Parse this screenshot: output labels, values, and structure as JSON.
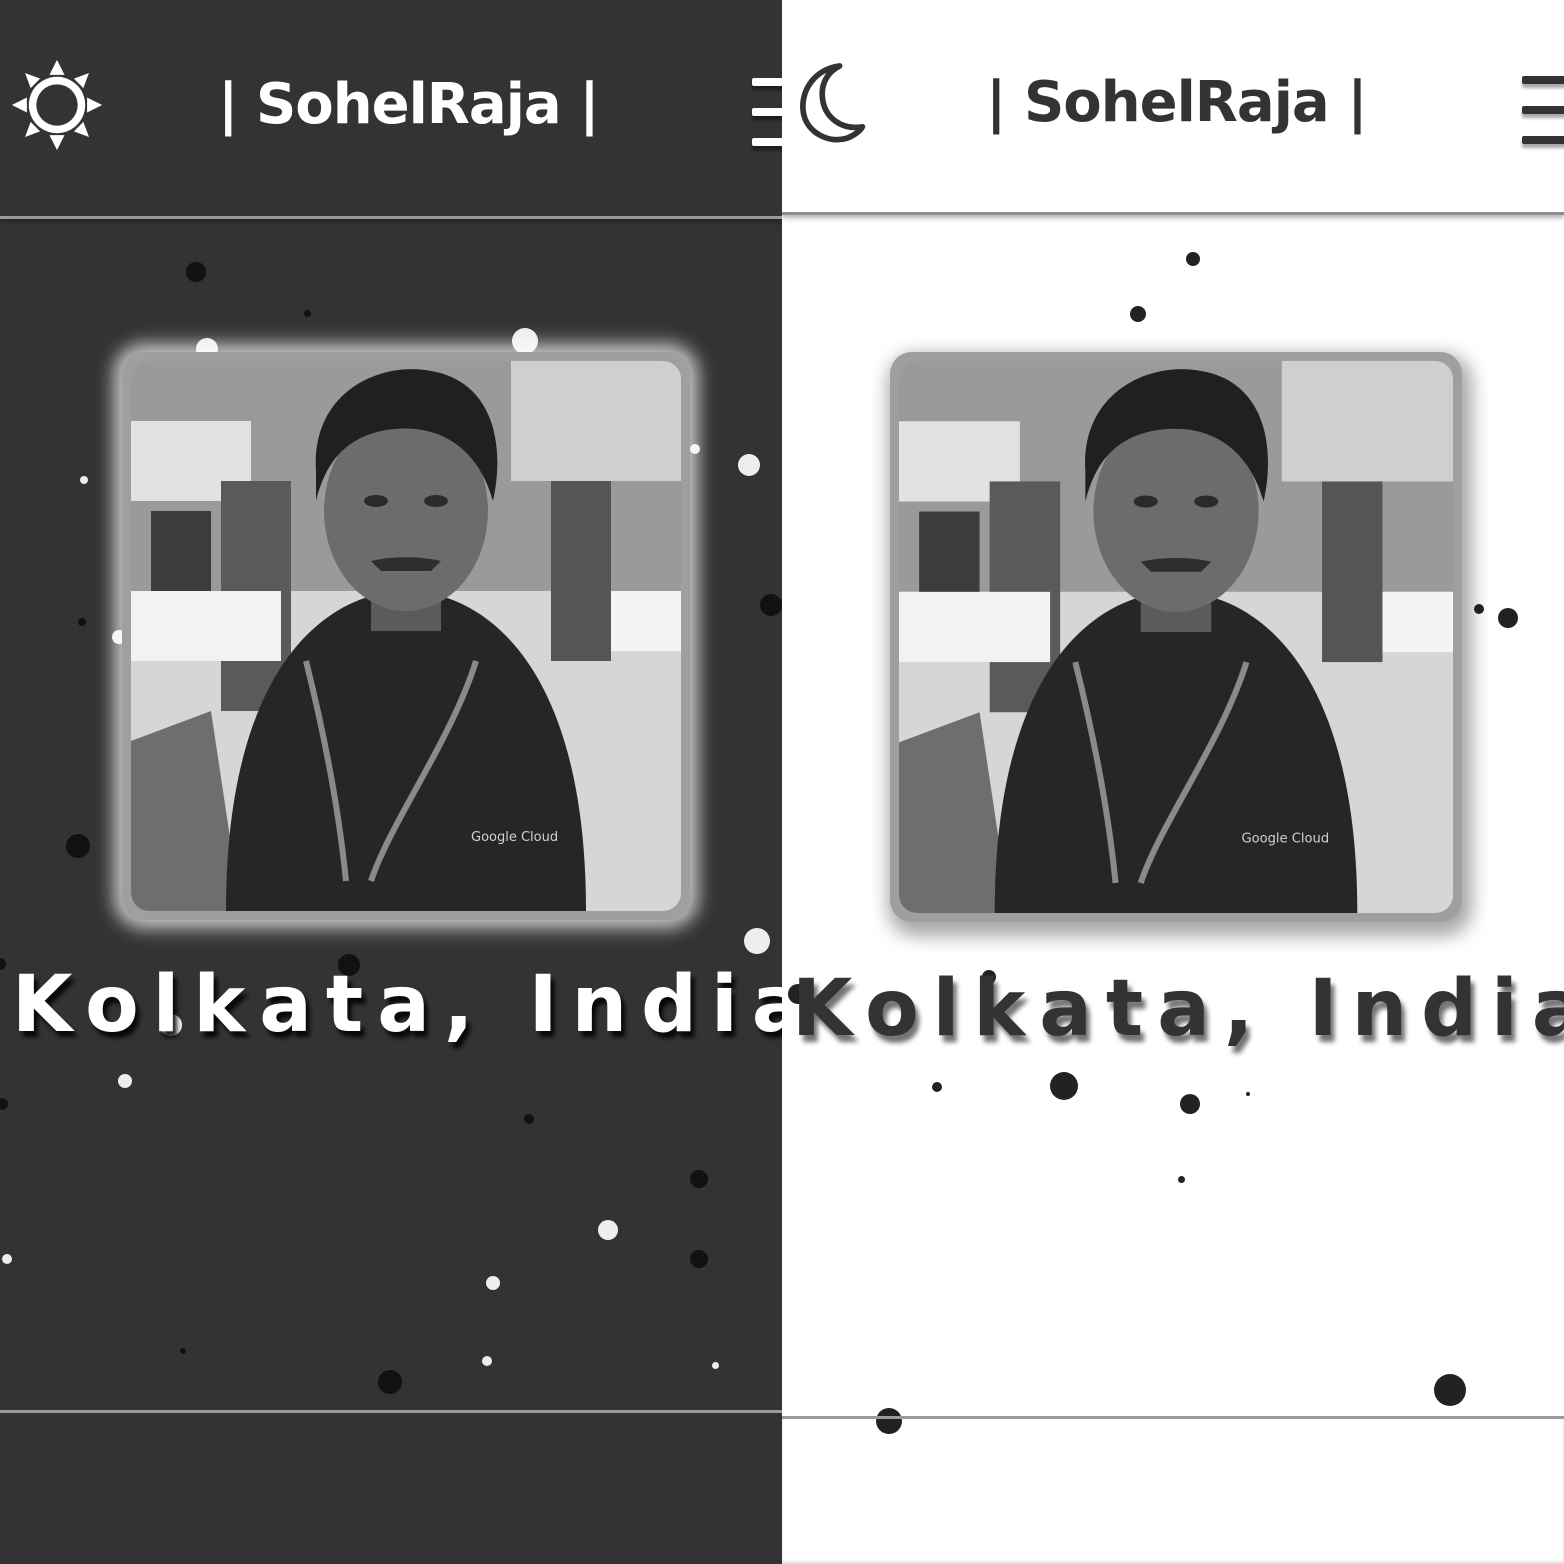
{
  "panels": {
    "dark": {
      "mode": "dark",
      "theme_toggle_icon": "sun-icon",
      "brand": "| SohelRaja |",
      "menu_icon": "hamburger-menu-icon",
      "location": "Kolkata, India",
      "colors": {
        "background": "#333333",
        "text": "#ffffff"
      }
    },
    "light": {
      "mode": "light",
      "theme_toggle_icon": "moon-icon",
      "brand": "| SohelRaja |",
      "menu_icon": "hamburger-menu-icon",
      "location": "Kolkata, India",
      "colors": {
        "background": "#ffffff",
        "text": "#333333"
      }
    }
  },
  "profile_photo": {
    "logo_text": "Google Cloud"
  }
}
